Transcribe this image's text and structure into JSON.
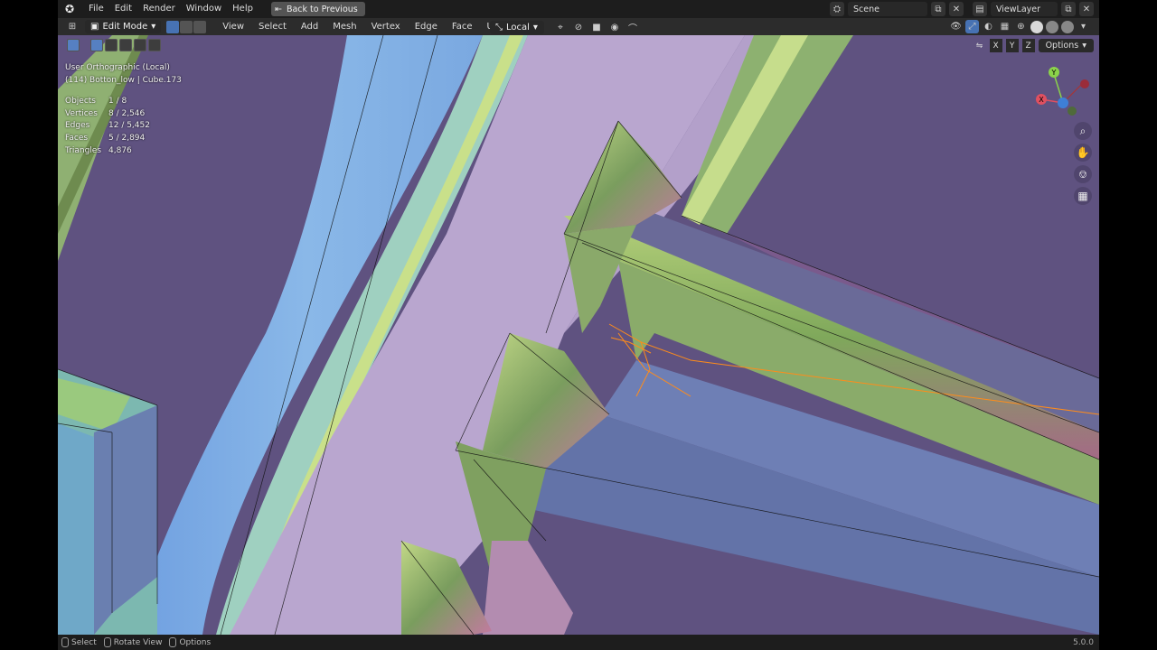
{
  "topbar": {
    "menus": [
      "File",
      "Edit",
      "Render",
      "Window",
      "Help"
    ],
    "back_button": "Back to Previous",
    "scene_label": "Scene",
    "viewlayer_label": "ViewLayer"
  },
  "viewport_header": {
    "mode": "Edit Mode",
    "menus": [
      "View",
      "Select",
      "Add",
      "Mesh",
      "Vertex",
      "Edge",
      "Face",
      "UV"
    ],
    "transform_orientation": "Local"
  },
  "axis_row": {
    "axes": [
      "X",
      "Y",
      "Z"
    ],
    "options_label": "Options"
  },
  "overlay": {
    "view_name": "User Orthographic (Local)",
    "object_info": "(114) Botton_low | Cube.173",
    "stats": [
      {
        "label": "Objects",
        "value": "1 / 8"
      },
      {
        "label": "Vertices",
        "value": "8 / 2,546"
      },
      {
        "label": "Edges",
        "value": "12 / 5,452"
      },
      {
        "label": "Faces",
        "value": "5 / 2,894"
      },
      {
        "label": "Triangles",
        "value": "4,876"
      }
    ]
  },
  "gizmo": {
    "y_label": "Y",
    "x_label": "X"
  },
  "statusbar": {
    "items": [
      "Select",
      "Rotate View",
      "Options"
    ],
    "version": "5.0.0"
  },
  "colors": {
    "accent": "#4772b3",
    "background": "#5b4e77",
    "selection": "#ff8c1a"
  }
}
